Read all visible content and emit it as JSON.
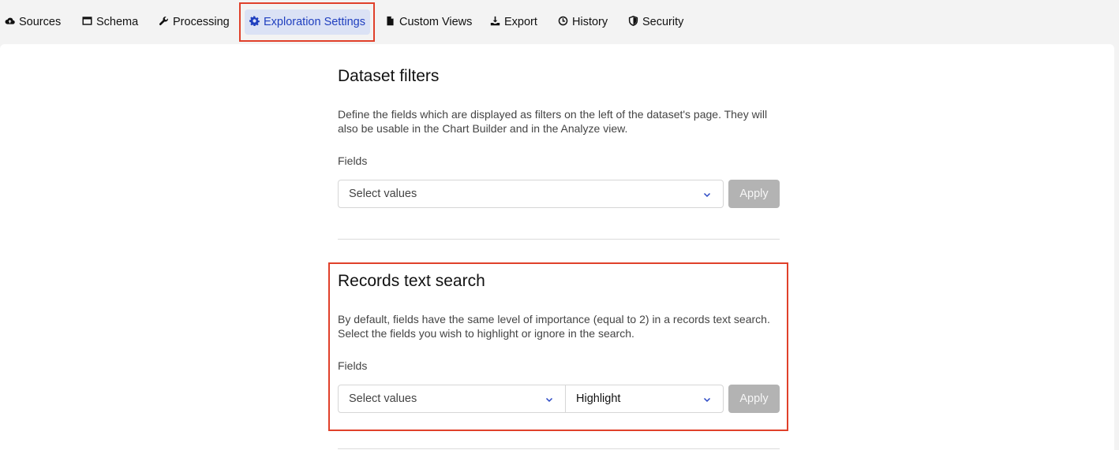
{
  "tabs": [
    {
      "label": "Sources",
      "icon": "cloud-upload-icon"
    },
    {
      "label": "Schema",
      "icon": "window-icon"
    },
    {
      "label": "Processing",
      "icon": "wrench-icon"
    },
    {
      "label": "Exploration Settings",
      "icon": "gear-icon",
      "active": true
    },
    {
      "label": "Custom Views",
      "icon": "file-icon"
    },
    {
      "label": "Export",
      "icon": "download-icon"
    },
    {
      "label": "History",
      "icon": "clock-icon"
    },
    {
      "label": "Security",
      "icon": "shield-icon"
    }
  ],
  "dataset_filters": {
    "title": "Dataset filters",
    "description": "Define the fields which are displayed as filters on the left of the dataset's page. They will also be usable in the Chart Builder and in the Analyze view.",
    "fields_label": "Fields",
    "select_placeholder": "Select values",
    "apply_label": "Apply"
  },
  "records_text_search": {
    "title": "Records text search",
    "description": "By default, fields have the same level of importance (equal to 2) in a records text search. Select the fields you wish to highlight or ignore in the search.",
    "fields_label": "Fields",
    "select_placeholder": "Select values",
    "mode_value": "Highlight",
    "apply_label": "Apply"
  },
  "colors": {
    "accent": "#1f3fbf",
    "active_tab_bg": "#dbe2f5",
    "highlight_border": "#e0402a",
    "disabled_button": "#b3b3b3"
  }
}
